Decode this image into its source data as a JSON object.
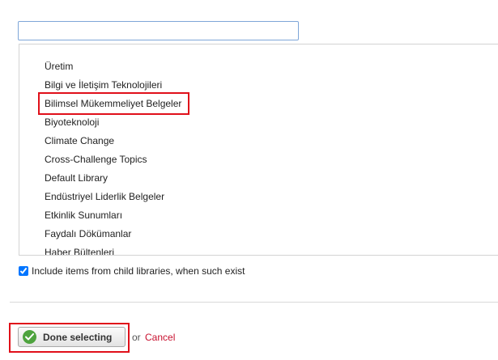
{
  "search": {
    "value": "",
    "placeholder": ""
  },
  "libraries": {
    "items": [
      "Üretim",
      "Bilgi ve İletişim Teknolojileri",
      "Bilimsel Mükemmeliyet Belgeler",
      "Biyoteknoloji",
      "Climate Change",
      "Cross-Challenge Topics",
      "Default Library",
      "Endüstriyel Liderlik Belgeler",
      "Etkinlik Sunumları",
      "Faydalı Dökümanlar",
      "Haber Bültenleri"
    ],
    "highlighted": "Bilimsel Mükemmeliyet Belgeler"
  },
  "options": {
    "include_child_libraries_label": "Include items from child libraries, when such exist",
    "include_child_libraries_checked": true
  },
  "actions": {
    "done_label": "Done selecting",
    "or_text": "or",
    "cancel_label": "Cancel"
  },
  "colors": {
    "highlight": "#e0101a",
    "check_icon": "#4ea33e",
    "cancel_link": "#c8102e",
    "search_border": "#7ea6d8"
  }
}
